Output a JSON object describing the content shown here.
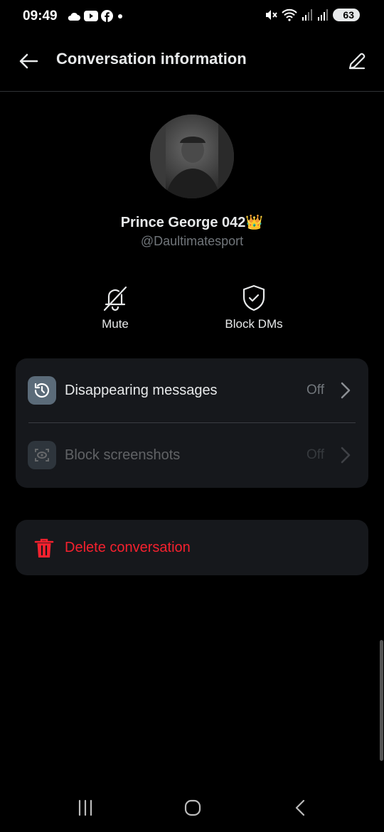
{
  "status_bar": {
    "time": "09:49",
    "battery": "63",
    "left_icons": [
      "cloud-icon",
      "youtube-icon",
      "facebook-icon",
      "dot-icon"
    ],
    "right_icons": [
      "mute-icon",
      "wifi-icon",
      "signal-icon",
      "signal-icon"
    ]
  },
  "header": {
    "title": "Conversation information",
    "back_icon": "arrow-left-icon",
    "edit_icon": "pencil-icon"
  },
  "profile": {
    "display_name": "Prince George 042👑",
    "handle": "@Daultimatesport"
  },
  "actions": [
    {
      "label": "Mute",
      "icon": "bell-off-icon"
    },
    {
      "label": "Block DMs",
      "icon": "shield-check-icon"
    }
  ],
  "settings": [
    {
      "label": "Disappearing messages",
      "value": "Off",
      "enabled": true,
      "icon": "timer-history-icon"
    },
    {
      "label": "Block screenshots",
      "value": "Off",
      "enabled": false,
      "icon": "screenshot-eye-icon"
    }
  ],
  "delete": {
    "label": "Delete conversation",
    "icon": "trash-icon",
    "color": "#f4212e"
  },
  "colors": {
    "background": "#000000",
    "card": "#16181c",
    "text_primary": "#e7e9ea",
    "text_secondary": "#71767b",
    "danger": "#f4212e"
  },
  "nav_bar": [
    "recents-icon",
    "home-icon",
    "back-icon"
  ]
}
